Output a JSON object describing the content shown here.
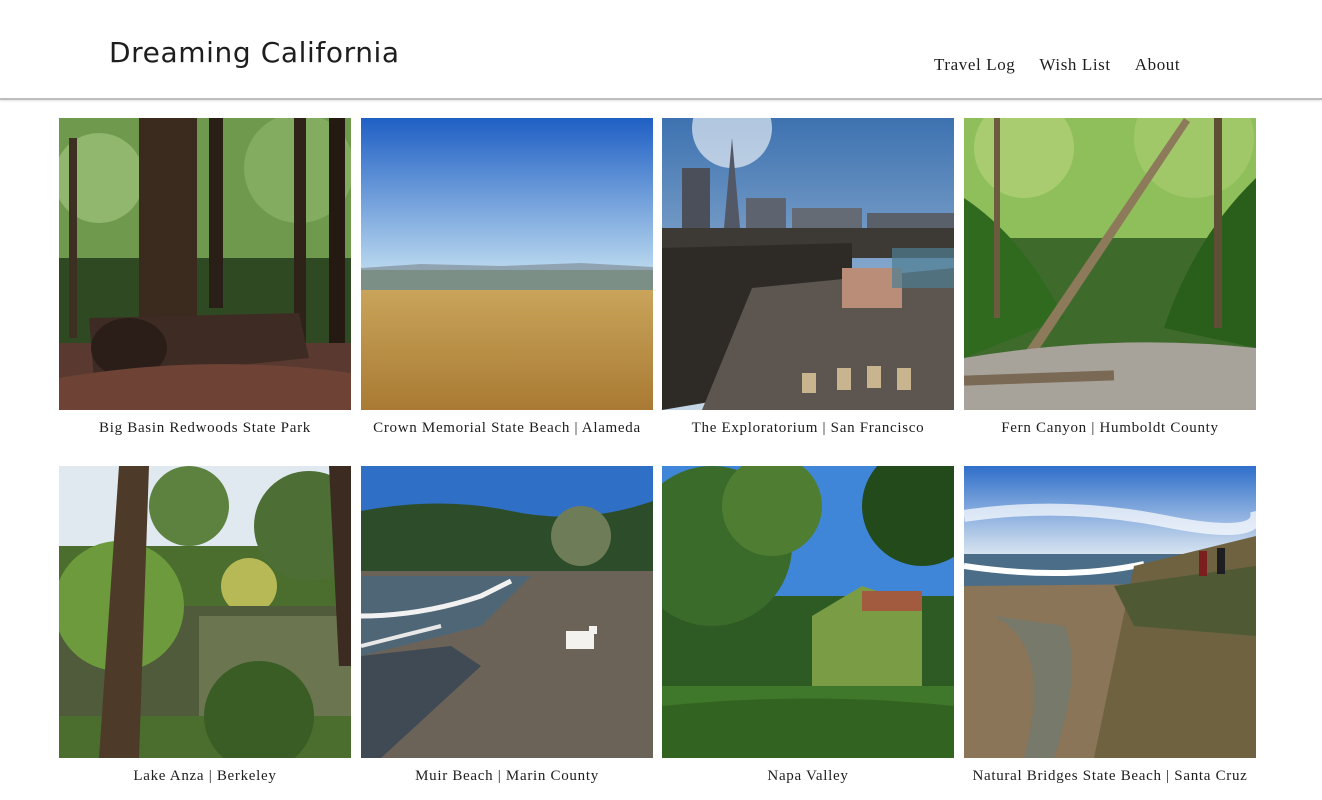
{
  "header": {
    "site_title": "Dreaming California",
    "nav": [
      "Travel Log",
      "Wish List",
      "About"
    ]
  },
  "gallery": [
    {
      "caption": "Big Basin Redwoods State Park"
    },
    {
      "caption": "Crown Memorial State Beach | Alameda"
    },
    {
      "caption": "The Exploratorium | San Francisco"
    },
    {
      "caption": "Fern Canyon | Humboldt County"
    },
    {
      "caption": "Lake Anza | Berkeley"
    },
    {
      "caption": "Muir Beach | Marin County"
    },
    {
      "caption": "Napa Valley"
    },
    {
      "caption": "Natural Bridges State Beach | Santa Cruz"
    }
  ]
}
